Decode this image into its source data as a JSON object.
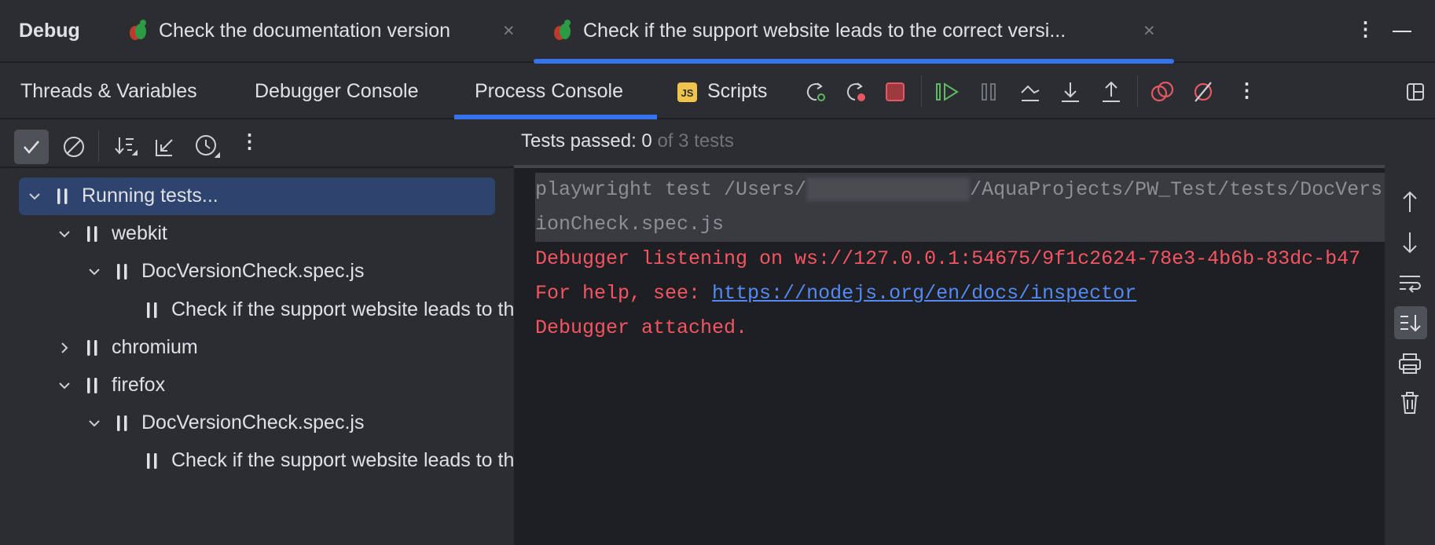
{
  "header": {
    "title": "Debug",
    "tabs": [
      {
        "label": "Check the documentation version",
        "active": false
      },
      {
        "label": "Check if the support website leads to the correct versi...",
        "active": true
      }
    ]
  },
  "subtabs": [
    {
      "label": "Threads & Variables"
    },
    {
      "label": "Debugger Console"
    },
    {
      "label": "Process Console",
      "active": true
    },
    {
      "label": "Scripts",
      "badge": "JS"
    }
  ],
  "status": {
    "label": "Tests passed:",
    "passed": "0",
    "of_text": "of 3 tests"
  },
  "tree": [
    {
      "label": "Running tests...",
      "level": 0,
      "expanded": true,
      "selected": true
    },
    {
      "label": "webkit",
      "level": 1,
      "expanded": true
    },
    {
      "label": "DocVersionCheck.spec.js",
      "level": 2,
      "expanded": true
    },
    {
      "label": "Check if the support website leads to the correct version",
      "level": 3
    },
    {
      "label": "chromium",
      "level": 1,
      "expanded": false
    },
    {
      "label": "firefox",
      "level": 1,
      "expanded": true
    },
    {
      "label": "DocVersionCheck.spec.js",
      "level": 2,
      "expanded": true
    },
    {
      "label": "Check if the support website leads to the correct version",
      "level": 3
    }
  ],
  "console": {
    "cmd_prefix": "playwright test /Users/",
    "cmd_suffix": "/AquaProjects/PW_Test/tests/DocVersionCheck.spec.js",
    "line1": "Debugger listening on ws://127.0.0.1:54675/9f1c2624-78e3-4b6b-83dc-b47",
    "line2_prefix": "For help, see: ",
    "line2_link": "https://nodejs.org/en/docs/inspector",
    "line3": "Debugger attached."
  },
  "colors": {
    "accent": "#3574f0",
    "error": "#f75464",
    "link": "#548af7",
    "run": "#5fb865"
  }
}
